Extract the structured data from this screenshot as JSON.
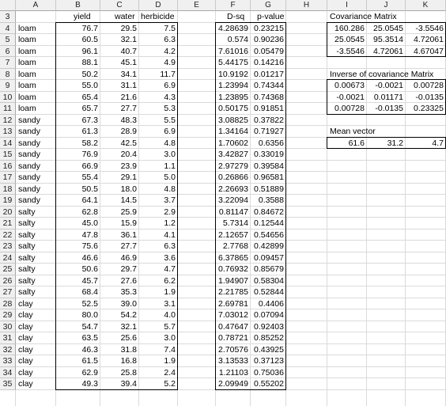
{
  "columns": [
    "A",
    "B",
    "C",
    "D",
    "E",
    "F",
    "G",
    "H",
    "I",
    "J",
    "K"
  ],
  "header_row": {
    "number": "3",
    "yield": "yield",
    "water": "water",
    "herbicide": "herbicide",
    "dsq": "D-sq",
    "pvalue": "p-value"
  },
  "rows": [
    {
      "n": "4",
      "soil": "loam",
      "yield": "76.7",
      "water": "29.5",
      "herb": "7.5",
      "dsq": "4.28639",
      "p": "0.23215"
    },
    {
      "n": "5",
      "soil": "loam",
      "yield": "60.5",
      "water": "32.1",
      "herb": "6.3",
      "dsq": "0.574",
      "p": "0.90236"
    },
    {
      "n": "6",
      "soil": "loam",
      "yield": "96.1",
      "water": "40.7",
      "herb": "4.2",
      "dsq": "7.61016",
      "p": "0.05479"
    },
    {
      "n": "7",
      "soil": "loam",
      "yield": "88.1",
      "water": "45.1",
      "herb": "4.9",
      "dsq": "5.44175",
      "p": "0.14216"
    },
    {
      "n": "8",
      "soil": "loam",
      "yield": "50.2",
      "water": "34.1",
      "herb": "11.7",
      "dsq": "10.9192",
      "p": "0.01217"
    },
    {
      "n": "9",
      "soil": "loam",
      "yield": "55.0",
      "water": "31.1",
      "herb": "6.9",
      "dsq": "1.23994",
      "p": "0.74344"
    },
    {
      "n": "10",
      "soil": "loam",
      "yield": "65.4",
      "water": "21.6",
      "herb": "4.3",
      "dsq": "1.23895",
      "p": "0.74368"
    },
    {
      "n": "11",
      "soil": "loam",
      "yield": "65.7",
      "water": "27.7",
      "herb": "5.3",
      "dsq": "0.50175",
      "p": "0.91851"
    },
    {
      "n": "12",
      "soil": "sandy",
      "yield": "67.3",
      "water": "48.3",
      "herb": "5.5",
      "dsq": "3.08825",
      "p": "0.37822"
    },
    {
      "n": "13",
      "soil": "sandy",
      "yield": "61.3",
      "water": "28.9",
      "herb": "6.9",
      "dsq": "1.34164",
      "p": "0.71927"
    },
    {
      "n": "14",
      "soil": "sandy",
      "yield": "58.2",
      "water": "42.5",
      "herb": "4.8",
      "dsq": "1.70602",
      "p": "0.6356"
    },
    {
      "n": "15",
      "soil": "sandy",
      "yield": "76.9",
      "water": "20.4",
      "herb": "3.0",
      "dsq": "3.42827",
      "p": "0.33019"
    },
    {
      "n": "16",
      "soil": "sandy",
      "yield": "66.9",
      "water": "23.9",
      "herb": "1.1",
      "dsq": "2.97279",
      "p": "0.39584"
    },
    {
      "n": "17",
      "soil": "sandy",
      "yield": "55.4",
      "water": "29.1",
      "herb": "5.0",
      "dsq": "0.26866",
      "p": "0.96581"
    },
    {
      "n": "18",
      "soil": "sandy",
      "yield": "50.5",
      "water": "18.0",
      "herb": "4.8",
      "dsq": "2.26693",
      "p": "0.51889"
    },
    {
      "n": "19",
      "soil": "sandy",
      "yield": "64.1",
      "water": "14.5",
      "herb": "3.7",
      "dsq": "3.22094",
      "p": "0.3588"
    },
    {
      "n": "20",
      "soil": "salty",
      "yield": "62.8",
      "water": "25.9",
      "herb": "2.9",
      "dsq": "0.81147",
      "p": "0.84672"
    },
    {
      "n": "21",
      "soil": "salty",
      "yield": "45.0",
      "water": "15.9",
      "herb": "1.2",
      "dsq": "5.7314",
      "p": "0.12544"
    },
    {
      "n": "22",
      "soil": "salty",
      "yield": "47.8",
      "water": "36.1",
      "herb": "4.1",
      "dsq": "2.12657",
      "p": "0.54656"
    },
    {
      "n": "23",
      "soil": "salty",
      "yield": "75.6",
      "water": "27.7",
      "herb": "6.3",
      "dsq": "2.7768",
      "p": "0.42899"
    },
    {
      "n": "24",
      "soil": "salty",
      "yield": "46.6",
      "water": "46.9",
      "herb": "3.6",
      "dsq": "6.37865",
      "p": "0.09457"
    },
    {
      "n": "25",
      "soil": "salty",
      "yield": "50.6",
      "water": "29.7",
      "herb": "4.7",
      "dsq": "0.76932",
      "p": "0.85679"
    },
    {
      "n": "26",
      "soil": "salty",
      "yield": "45.7",
      "water": "27.6",
      "herb": "6.2",
      "dsq": "1.94907",
      "p": "0.58304"
    },
    {
      "n": "27",
      "soil": "salty",
      "yield": "68.4",
      "water": "35.3",
      "herb": "1.9",
      "dsq": "2.21785",
      "p": "0.52844"
    },
    {
      "n": "28",
      "soil": "clay",
      "yield": "52.5",
      "water": "39.0",
      "herb": "3.1",
      "dsq": "2.69781",
      "p": "0.4406"
    },
    {
      "n": "29",
      "soil": "clay",
      "yield": "80.0",
      "water": "54.2",
      "herb": "4.0",
      "dsq": "7.03012",
      "p": "0.07094"
    },
    {
      "n": "30",
      "soil": "clay",
      "yield": "54.7",
      "water": "32.1",
      "herb": "5.7",
      "dsq": "0.47647",
      "p": "0.92403"
    },
    {
      "n": "31",
      "soil": "clay",
      "yield": "63.5",
      "water": "25.6",
      "herb": "3.0",
      "dsq": "0.78721",
      "p": "0.85252"
    },
    {
      "n": "32",
      "soil": "clay",
      "yield": "46.3",
      "water": "31.8",
      "herb": "7.4",
      "dsq": "2.70576",
      "p": "0.43925"
    },
    {
      "n": "33",
      "soil": "clay",
      "yield": "61.5",
      "water": "16.8",
      "herb": "1.9",
      "dsq": "3.13533",
      "p": "0.37123"
    },
    {
      "n": "34",
      "soil": "clay",
      "yield": "62.9",
      "water": "25.8",
      "herb": "2.4",
      "dsq": "1.21103",
      "p": "0.75036"
    },
    {
      "n": "35",
      "soil": "clay",
      "yield": "49.3",
      "water": "39.4",
      "herb": "5.2",
      "dsq": "2.09949",
      "p": "0.55202"
    }
  ],
  "covariance": {
    "title": "Covariance Matrix",
    "matrix": [
      [
        "160.286",
        "25.0545",
        "-3.5546"
      ],
      [
        "25.0545",
        "95.3514",
        "4.72061"
      ],
      [
        "-3.5546",
        "4.72061",
        "4.67047"
      ]
    ]
  },
  "inverse": {
    "title": "Inverse of covariance Matrix",
    "matrix": [
      [
        "0.00673",
        "-0.0021",
        "0.00728"
      ],
      [
        "-0.0021",
        "0.01171",
        "-0.0135"
      ],
      [
        "0.00728",
        "-0.0135",
        "0.23325"
      ]
    ]
  },
  "mean": {
    "title": "Mean vector",
    "values": [
      "61.6",
      "31.2",
      "4.7"
    ]
  }
}
